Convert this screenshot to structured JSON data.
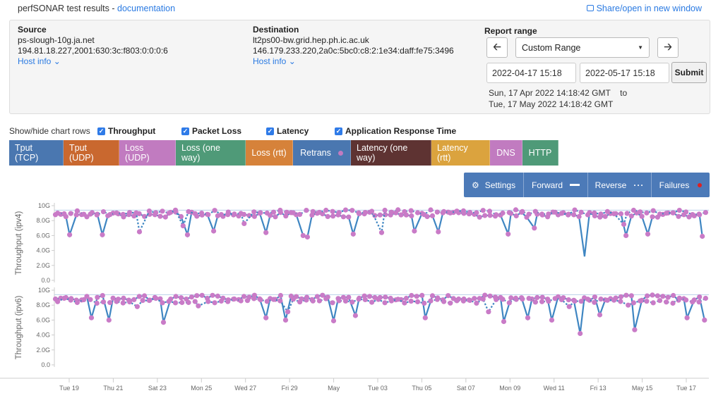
{
  "header": {
    "title": "perfSONAR test results - ",
    "doc_link": "documentation",
    "share_link": "Share/open in new window",
    "share_icon": "share-icon"
  },
  "source": {
    "label": "Source",
    "host": "ps-slough-10g.ja.net",
    "addresses": "194.81.18.227,2001:630:3c:f803:0:0:0:6",
    "hostinfo": "Host info ⌄"
  },
  "destination": {
    "label": "Destination",
    "host": "lt2ps00-bw.grid.hep.ph.ic.ac.uk",
    "addresses": "146.179.233.220,2a0c:5bc0:c8:2:1e34:daff:fe75:3496",
    "hostinfo": "Host info ⌄"
  },
  "report_range": {
    "label": "Report range",
    "prev_icon": "arrow-left-icon",
    "next_icon": "arrow-right-icon",
    "prev_glyph": "🡠",
    "selected": "Custom Range",
    "start_input": "2022-04-17 15:18",
    "end_input": "2022-05-17 15:18",
    "submit": "Submit",
    "start_text": "Sun, 17 Apr 2022 14:18:42 GMT",
    "to": "to",
    "end_text": "Tue, 17 May 2022 14:18:42 GMT"
  },
  "showhide": {
    "label": "Show/hide chart rows",
    "checkboxes": [
      {
        "label": "Throughput",
        "checked": true
      },
      {
        "label": "Packet Loss",
        "checked": true
      },
      {
        "label": "Latency",
        "checked": true
      },
      {
        "label": "Application Response Time",
        "checked": true
      }
    ]
  },
  "row_buttons": [
    {
      "label": "Tput (TCP)",
      "color": "#4a77b0"
    },
    {
      "label": "Tput (UDP)",
      "color": "#c9682f"
    },
    {
      "label": "Loss (UDP)",
      "color": "#c17bc0"
    },
    {
      "label": "Loss (one way)",
      "color": "#4f9a78"
    },
    {
      "label": "Loss (rtt)",
      "color": "#d6823a"
    },
    {
      "label": "Retrans",
      "color": "#4a77b0"
    },
    {
      "label": "Latency (one way)",
      "color": "#5e3332"
    },
    {
      "label": "Latency (rtt)",
      "color": "#dba33e"
    },
    {
      "label": "DNS",
      "color": "#c17bc0"
    },
    {
      "label": "HTTP",
      "color": "#4f9a78"
    }
  ],
  "controls": {
    "settings": "Settings",
    "forward": "Forward",
    "reverse": "Reverse",
    "failures": "Failures"
  },
  "colors": {
    "line": "#3f86c2",
    "point": "#c97bc7",
    "failure": "#e02020",
    "cap": "#b8d0ea"
  },
  "chart_data": [
    {
      "type": "line",
      "ylabel": "Throughput (ipv4)",
      "yticks": [
        "0.0",
        "2.0G",
        "4.0G",
        "6.0G",
        "8.0G",
        "10G"
      ],
      "ylim": [
        0,
        10
      ],
      "yunit": "Gbps",
      "capacity": 9.4,
      "x_range_days": [
        0,
        30
      ],
      "series": [
        {
          "name": "Forward",
          "style": "solid",
          "baseline": 8.8,
          "dips": [
            [
              0.7,
              6.1
            ],
            [
              2.2,
              6.1
            ],
            [
              6.1,
              6.1
            ],
            [
              7.3,
              6.6
            ],
            [
              9.7,
              6.4
            ],
            [
              11.4,
              6.0
            ],
            [
              11.6,
              5.8
            ],
            [
              13.7,
              6.2
            ],
            [
              16.5,
              6.6
            ],
            [
              17.6,
              6.5
            ],
            [
              20.8,
              6.2
            ],
            [
              22.0,
              7.0
            ],
            [
              24.3,
              3.2
            ],
            [
              26.2,
              6.0
            ],
            [
              27.2,
              6.2
            ],
            [
              29.7,
              5.9
            ]
          ]
        },
        {
          "name": "Reverse",
          "style": "dotted",
          "baseline": 9.1,
          "dips": [
            [
              3.9,
              6.5
            ],
            [
              5.9,
              7.3
            ],
            [
              8.7,
              7.6
            ],
            [
              15.0,
              6.4
            ],
            [
              26.1,
              7.5
            ]
          ]
        }
      ]
    },
    {
      "type": "line",
      "ylabel": "Throughput (ipv6)",
      "yticks": [
        "0.0",
        "2.0G",
        "4.0G",
        "6.0G",
        "8.0G",
        "10G"
      ],
      "ylim": [
        0,
        10
      ],
      "yunit": "Gbps",
      "capacity": 9.4,
      "x_range_days": [
        0,
        30
      ],
      "series": [
        {
          "name": "Forward",
          "style": "solid",
          "baseline": 9.0,
          "dips": [
            [
              1.7,
              6.3
            ],
            [
              2.5,
              6.0
            ],
            [
              5.0,
              5.7
            ],
            [
              9.7,
              6.3
            ],
            [
              10.6,
              6.0
            ],
            [
              12.8,
              5.9
            ],
            [
              13.8,
              6.6
            ],
            [
              17.0,
              6.3
            ],
            [
              20.6,
              5.8
            ],
            [
              21.7,
              6.3
            ],
            [
              22.8,
              6.0
            ],
            [
              24.1,
              4.2
            ],
            [
              25.0,
              6.7
            ],
            [
              26.6,
              4.7
            ],
            [
              29.0,
              6.3
            ],
            [
              29.8,
              6.0
            ]
          ]
        },
        {
          "name": "Reverse",
          "style": "dotted",
          "baseline": 8.6,
          "dips": [
            [
              3.8,
              7.8
            ],
            [
              6.6,
              7.9
            ],
            [
              10.7,
              7.1
            ],
            [
              19.9,
              7.1
            ],
            [
              23.6,
              7.8
            ],
            [
              26.3,
              8.0
            ]
          ]
        }
      ]
    }
  ],
  "x_axis": {
    "ticks": [
      {
        "label": "Tue 19",
        "day": 2.0
      },
      {
        "label": "Thu 21",
        "day": 4.0
      },
      {
        "label": "Sat 23",
        "day": 6.0
      },
      {
        "label": "Mon 25",
        "day": 8.0
      },
      {
        "label": "Wed 27",
        "day": 10.0
      },
      {
        "label": "Fri 29",
        "day": 12.0
      },
      {
        "label": "May",
        "day": 14.0
      },
      {
        "label": "Tue 03",
        "day": 16.0
      },
      {
        "label": "Thu 05",
        "day": 18.0
      },
      {
        "label": "Sat 07",
        "day": 20.0
      },
      {
        "label": "Mon 09",
        "day": 22.0
      },
      {
        "label": "Wed 11",
        "day": 24.0
      },
      {
        "label": "Fri 13",
        "day": 26.0
      },
      {
        "label": "May 15",
        "day": 28.0
      },
      {
        "label": "Tue 17",
        "day": 30.0
      }
    ]
  }
}
